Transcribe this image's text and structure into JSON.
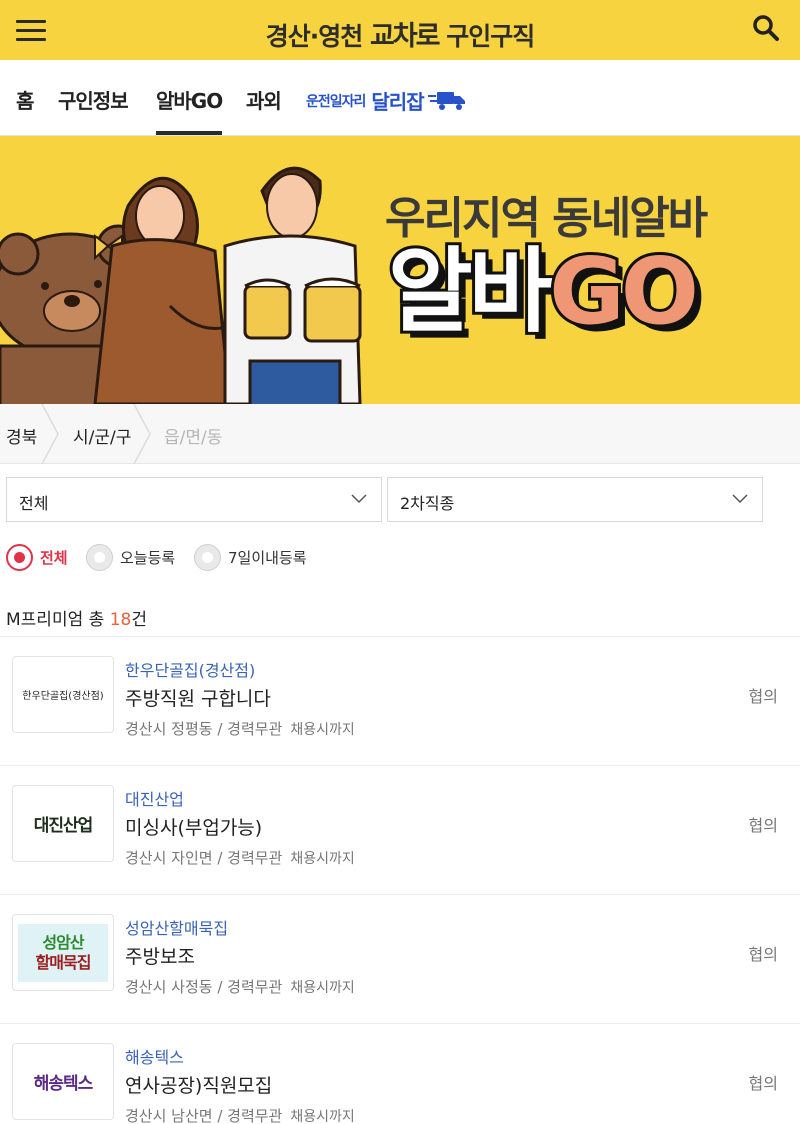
{
  "header": {
    "title_prefix": "경산·영천",
    "title_brand": "교차로",
    "title_suffix": "구인구직",
    "menu_icon": "hamburger-menu-icon",
    "search_icon": "search-icon",
    "bg_color": "#f7d33f"
  },
  "nav": {
    "tabs": [
      {
        "label": "홈"
      },
      {
        "label": "구인정보"
      },
      {
        "label": "알바GO",
        "active": true
      },
      {
        "label": "과외"
      }
    ],
    "dalijab": {
      "small": "운전일자리",
      "big": "달리잡",
      "icon": "delivery-truck-icon",
      "color": "#2752c9"
    }
  },
  "banner": {
    "line1": "우리지역 동네알바",
    "line2_word": "알바",
    "line2_go": "GO"
  },
  "region": {
    "crumbs": [
      "경북",
      "시/군/구",
      "읍/면/동"
    ]
  },
  "filters": {
    "category": "전체",
    "subcategory": "2차직종"
  },
  "radios": [
    {
      "label": "전체",
      "checked": true
    },
    {
      "label": "오늘등록",
      "checked": false
    },
    {
      "label": "7일이내등록",
      "checked": false
    }
  ],
  "count": {
    "prefix": "M프리미엄 총 ",
    "number": "18",
    "suffix": "건"
  },
  "listings": [
    {
      "logo_text": "한우단골집(경산점)",
      "company": "한우단골집(경산점)",
      "title": "주방직원 구합니다",
      "location": "경산시 정평동 / 경력무관",
      "until": "채용시까지",
      "pay": "협의"
    },
    {
      "logo_text": "대진산업",
      "company": "대진산업",
      "title": "미싱사(부업가능)",
      "location": "경산시 자인면 / 경력무관",
      "until": "채용시까지",
      "pay": "협의"
    },
    {
      "logo_line1": "성암산",
      "logo_line2": "할매묵집",
      "company": "성암산할매묵집",
      "title": "주방보조",
      "location": "경산시 사정동 / 경력무관",
      "until": "채용시까지",
      "pay": "협의"
    },
    {
      "logo_text": "해송텍스",
      "company": "해송텍스",
      "title": "연사공장)직원모집",
      "location": "경산시 남산면 / 경력무관",
      "until": "채용시까지",
      "pay": "협의"
    }
  ],
  "colors": {
    "accent_red": "#e0334a",
    "count_orange": "#e8623d",
    "company_blue": "#3a63b8"
  }
}
